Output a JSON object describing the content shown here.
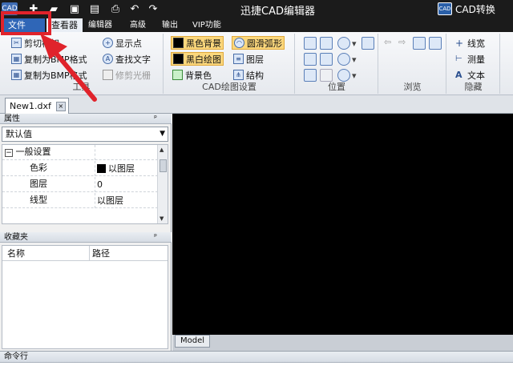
{
  "titlebar": {
    "app_icon": "CAD",
    "quick_access": [
      "new-file-icon",
      "open-folder-icon",
      "save-icon",
      "save-as-icon",
      "print-icon",
      "undo-icon",
      "redo-icon"
    ],
    "title": "迅捷CAD编辑器",
    "convert_logo": "CAD",
    "convert_label": "CAD转换"
  },
  "menu": {
    "file": "文件",
    "tabs": [
      "查看器",
      "编辑器",
      "高级",
      "输出",
      "VIP功能"
    ]
  },
  "ribbon": {
    "tools": {
      "label": "工具",
      "items": [
        "剪切框架",
        "复制为BMP格式",
        "复制为BMP格式",
        "显示点",
        "查找文字",
        "修剪光栅"
      ]
    },
    "cad_settings": {
      "label": "CAD绘图设置",
      "items": [
        "黑色背景",
        "黑白绘图",
        "背景色",
        "圆滑弧形",
        "图层",
        "结构"
      ]
    },
    "position": {
      "label": "位置"
    },
    "browse": {
      "label": "浏览"
    },
    "hide": {
      "label": "隐藏",
      "items": [
        "线宽",
        "测量",
        "文本"
      ]
    }
  },
  "document": {
    "tab": "New1.dxf",
    "close": "×"
  },
  "properties": {
    "title": "属性",
    "pin": "ᵖ",
    "dropdown": "默认值",
    "section": "一般设置",
    "expander": "−",
    "rows": [
      {
        "key": "色彩",
        "value": "以图层"
      },
      {
        "key": "图层",
        "value": "0"
      },
      {
        "key": "线型",
        "value": "以图层"
      }
    ]
  },
  "favorites": {
    "title": "收藏夹",
    "pin": "ᵖ",
    "columns": [
      "名称",
      "路径"
    ]
  },
  "canvas": {
    "background": "#000000",
    "model_tab": "Model"
  },
  "command": {
    "title": "命令行"
  },
  "colors": {
    "accent": "#2f66b7",
    "annotation": "#e0232b"
  }
}
